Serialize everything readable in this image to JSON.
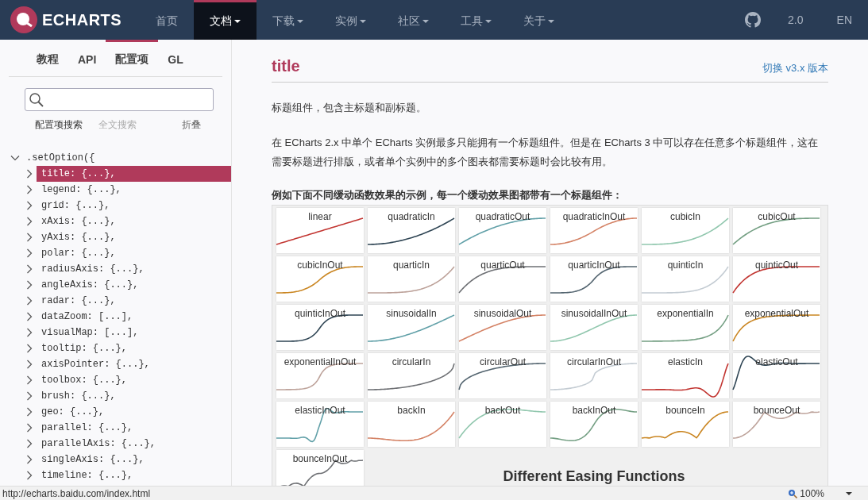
{
  "header": {
    "logo_text": "ECHARTS",
    "nav": [
      {
        "label": "首页",
        "dropdown": false,
        "selected": false
      },
      {
        "label": "文档",
        "dropdown": true,
        "selected": true
      },
      {
        "label": "下载",
        "dropdown": true,
        "selected": false
      },
      {
        "label": "实例",
        "dropdown": true,
        "selected": false
      },
      {
        "label": "社区",
        "dropdown": true,
        "selected": false
      },
      {
        "label": "工具",
        "dropdown": true,
        "selected": false
      },
      {
        "label": "关于",
        "dropdown": true,
        "selected": false
      }
    ],
    "version": "2.0",
    "language": "EN"
  },
  "sidebar": {
    "tabs": [
      {
        "label": "教程",
        "selected": false
      },
      {
        "label": "API",
        "selected": false
      },
      {
        "label": "配置项",
        "selected": true
      },
      {
        "label": "GL",
        "selected": false
      }
    ],
    "search_modes": [
      {
        "label": "配置项搜索",
        "selected": true
      },
      {
        "label": "全文搜索",
        "selected": false
      }
    ],
    "collapse_label": "折叠",
    "tree": {
      "label": ".setOption({",
      "expanded": true,
      "children": [
        {
          "label": "title: {...},",
          "selected": true,
          "expanded": false
        },
        {
          "label": "legend: {...},",
          "selected": false,
          "expanded": false
        },
        {
          "label": "grid: {...},",
          "selected": false,
          "expanded": false
        },
        {
          "label": "xAxis: {...},",
          "selected": false,
          "expanded": false
        },
        {
          "label": "yAxis: {...},",
          "selected": false,
          "expanded": false
        },
        {
          "label": "polar: {...},",
          "selected": false,
          "expanded": false
        },
        {
          "label": "radiusAxis: {...},",
          "selected": false,
          "expanded": false
        },
        {
          "label": "angleAxis: {...},",
          "selected": false,
          "expanded": false
        },
        {
          "label": "radar: {...},",
          "selected": false,
          "expanded": false
        },
        {
          "label": "dataZoom: [...],",
          "selected": false,
          "expanded": false
        },
        {
          "label": "visualMap: [...],",
          "selected": false,
          "expanded": false
        },
        {
          "label": "tooltip: {...},",
          "selected": false,
          "expanded": false
        },
        {
          "label": "axisPointer: {...},",
          "selected": false,
          "expanded": false
        },
        {
          "label": "toolbox: {...},",
          "selected": false,
          "expanded": false
        },
        {
          "label": "brush: {...},",
          "selected": false,
          "expanded": false
        },
        {
          "label": "geo: {...},",
          "selected": false,
          "expanded": false
        },
        {
          "label": "parallel: {...},",
          "selected": false,
          "expanded": false
        },
        {
          "label": "parallelAxis: {...},",
          "selected": false,
          "expanded": false
        },
        {
          "label": "singleAxis: {...},",
          "selected": false,
          "expanded": false
        },
        {
          "label": "timeline: {...},",
          "selected": false,
          "expanded": false
        }
      ]
    }
  },
  "content": {
    "title": "title",
    "switch_link": "切换 v3.x 版本",
    "paragraphs": [
      "标题组件，包含主标题和副标题。",
      "在 ECharts 2.x 中单个 ECharts 实例最多只能拥有一个标题组件。但是在 ECharts 3 中可以存在任意多个标题组件，这在需要标题进行排版，或者单个实例中的多个图表都需要标题时会比较有用。"
    ],
    "example_caption": "例如下面不同缓动函数效果的示例，每一个缓动效果图都带有一个标题组件：",
    "examples": [
      {
        "name": "linear",
        "color": "#c23531"
      },
      {
        "name": "quadraticIn",
        "color": "#2f4554"
      },
      {
        "name": "quadraticOut",
        "color": "#61a0a8"
      },
      {
        "name": "quadraticInOut",
        "color": "#d48265"
      },
      {
        "name": "cubicIn",
        "color": "#91c7ae"
      },
      {
        "name": "cubicOut",
        "color": "#749f83"
      },
      {
        "name": "cubicInOut",
        "color": "#ca8622"
      },
      {
        "name": "quarticIn",
        "color": "#bda29a"
      },
      {
        "name": "quarticOut",
        "color": "#6e7074"
      },
      {
        "name": "quarticInOut",
        "color": "#546570"
      },
      {
        "name": "quinticIn",
        "color": "#c4ccd3"
      },
      {
        "name": "quinticOut",
        "color": "#c23531"
      },
      {
        "name": "quinticInOut",
        "color": "#2f4554"
      },
      {
        "name": "sinusoidalIn",
        "color": "#61a0a8"
      },
      {
        "name": "sinusoidalOut",
        "color": "#d48265"
      },
      {
        "name": "sinusoidalInOut",
        "color": "#91c7ae"
      },
      {
        "name": "exponentialIn",
        "color": "#749f83"
      },
      {
        "name": "exponentialOut",
        "color": "#ca8622"
      },
      {
        "name": "exponentialInOut",
        "color": "#bda29a"
      },
      {
        "name": "circularIn",
        "color": "#6e7074"
      },
      {
        "name": "circularOut",
        "color": "#546570"
      },
      {
        "name": "circularInOut",
        "color": "#c4ccd3"
      },
      {
        "name": "elasticIn",
        "color": "#c23531"
      },
      {
        "name": "elasticOut",
        "color": "#2f4554"
      },
      {
        "name": "elasticInOut",
        "color": "#61a0a8"
      },
      {
        "name": "backIn",
        "color": "#d48265"
      },
      {
        "name": "backOut",
        "color": "#91c7ae"
      },
      {
        "name": "backInOut",
        "color": "#749f83"
      },
      {
        "name": "bounceIn",
        "color": "#ca8622"
      },
      {
        "name": "bounceOut",
        "color": "#bda29a"
      },
      {
        "name": "bounceInOut",
        "color": "#6e7074"
      }
    ],
    "examples_heading": "Different Easing Functions"
  },
  "status_bar": {
    "url": "http://echarts.baidu.com/index.html",
    "zoom": "100%"
  }
}
